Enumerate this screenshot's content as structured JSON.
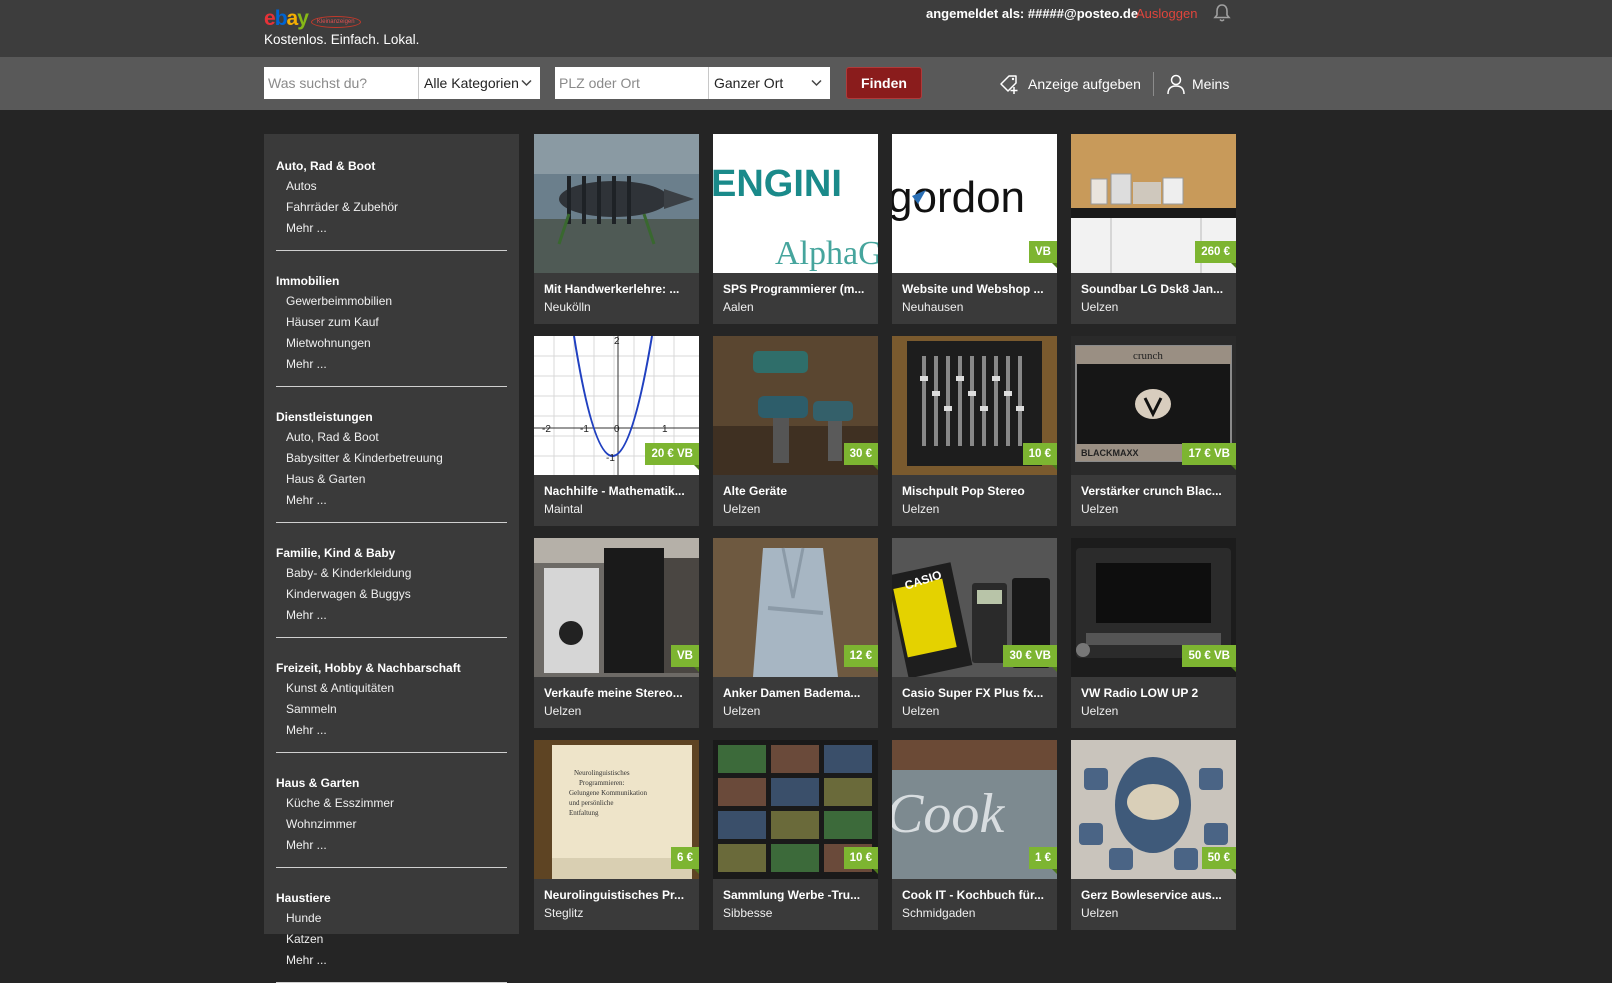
{
  "header": {
    "logo_text": "ebay",
    "logo_badge": "Kleinanzeigen",
    "slogan": "Kostenlos. Einfach. Lokal.",
    "logged_in_label": "angemeldet als: #####@posteo.de",
    "logout_label": "Ausloggen"
  },
  "search": {
    "query_placeholder": "Was suchst du?",
    "category_selected": "Alle Kategorien",
    "location_placeholder": "PLZ oder Ort",
    "radius_selected": "Ganzer Ort",
    "find_label": "Finden"
  },
  "actions": {
    "post_ad_label": "Anzeige aufgeben",
    "meins_label": "Meins"
  },
  "colors": {
    "accent_red": "#8a1c1c",
    "logout_red": "#e0453c",
    "price_green": "#7db531",
    "header_bg": "#3d3d3d",
    "searchbar_bg": "#595959",
    "page_bg": "#252525"
  },
  "sidebar": {
    "groups": [
      {
        "title": "Auto, Rad & Boot",
        "links": [
          "Autos",
          "Fahrräder & Zubehör",
          "Mehr ..."
        ]
      },
      {
        "title": "Immobilien",
        "links": [
          "Gewerbeimmobilien",
          "Häuser zum Kauf",
          "Mietwohnungen",
          "Mehr ..."
        ]
      },
      {
        "title": "Dienstleistungen",
        "links": [
          "Auto, Rad & Boot",
          "Babysitter & Kinderbetreuung",
          "Haus & Garten",
          "Mehr ..."
        ]
      },
      {
        "title": "Familie, Kind & Baby",
        "links": [
          "Baby- & Kinderkleidung",
          "Kinderwagen & Buggys",
          "Mehr ..."
        ]
      },
      {
        "title": "Freizeit, Hobby & Nachbarschaft",
        "links": [
          "Kunst & Antiquitäten",
          "Sammeln",
          "Mehr ..."
        ]
      },
      {
        "title": "Haus & Garten",
        "links": [
          "Küche & Esszimmer",
          "Wohnzimmer",
          "Mehr ..."
        ]
      },
      {
        "title": "Haustiere",
        "links": [
          "Hunde",
          "Katzen",
          "Mehr ..."
        ]
      }
    ]
  },
  "listings": [
    {
      "title": "Mit Handwerkerlehre: ...",
      "location": "Neukölln",
      "price": "",
      "image": "machine-photo"
    },
    {
      "title": "SPS Programmierer (m...",
      "location": "Aalen",
      "price": "",
      "image": "engineering-logo",
      "image_text": [
        "ENGINI",
        "AlphaG"
      ]
    },
    {
      "title": "Website und Webshop ...",
      "location": "Neuhausen",
      "price": "VB",
      "image": "gordon-logo",
      "image_text": [
        "gordon"
      ]
    },
    {
      "title": "Soundbar LG Dsk8 Jan...",
      "location": "Uelzen",
      "price": "260 €",
      "image": "tv-shelf-photo"
    },
    {
      "title": "Nachhilfe - Mathematik...",
      "location": "Maintal",
      "price": "20 € VB",
      "image": "math-graph",
      "image_text": [
        "2",
        "1",
        "-2",
        "-1",
        "0",
        "-1"
      ]
    },
    {
      "title": "Alte Geräte",
      "location": "Uelzen",
      "price": "30 €",
      "image": "power-tools-photo"
    },
    {
      "title": "Mischpult Pop Stereo",
      "location": "Uelzen",
      "price": "10 €",
      "image": "mixer-photo"
    },
    {
      "title": "Verstärker crunch Blac...",
      "location": "Uelzen",
      "price": "17 € VB",
      "image": "amplifier-photo",
      "image_text": [
        "crunch",
        "BLACKMAXX"
      ]
    },
    {
      "title": "Verkaufe meine Stereo...",
      "location": "Uelzen",
      "price": "VB",
      "image": "speakers-photo"
    },
    {
      "title": "Anker Damen Badema...",
      "location": "Uelzen",
      "price": "12 €",
      "image": "bathrobe-photo"
    },
    {
      "title": "Casio Super FX Plus fx...",
      "location": "Uelzen",
      "price": "30 € VB",
      "image": "calculator-photo",
      "image_text": [
        "CASIO"
      ]
    },
    {
      "title": "VW Radio LOW UP 2",
      "location": "Uelzen",
      "price": "50 € VB",
      "image": "car-radio-photo"
    },
    {
      "title": "Neurolinguistisches Pr...",
      "location": "Steglitz",
      "price": "6 €",
      "image": "book-photo",
      "image_text": [
        "Neurolinguistisches",
        "Programmieren:",
        "Gelungene Kommunikation",
        "und persönliche",
        "Entfaltung"
      ]
    },
    {
      "title": "Sammlung Werbe -Tru...",
      "location": "Sibbesse",
      "price": "10 €",
      "image": "truck-collection-photo"
    },
    {
      "title": "Cook IT - Kochbuch für...",
      "location": "Schmidgaden",
      "price": "1 €",
      "image": "cookbook-photo",
      "image_text": [
        "Cook"
      ]
    },
    {
      "title": "Gerz Bowleservice aus...",
      "location": "Uelzen",
      "price": "50 €",
      "image": "bowl-set-photo"
    }
  ]
}
